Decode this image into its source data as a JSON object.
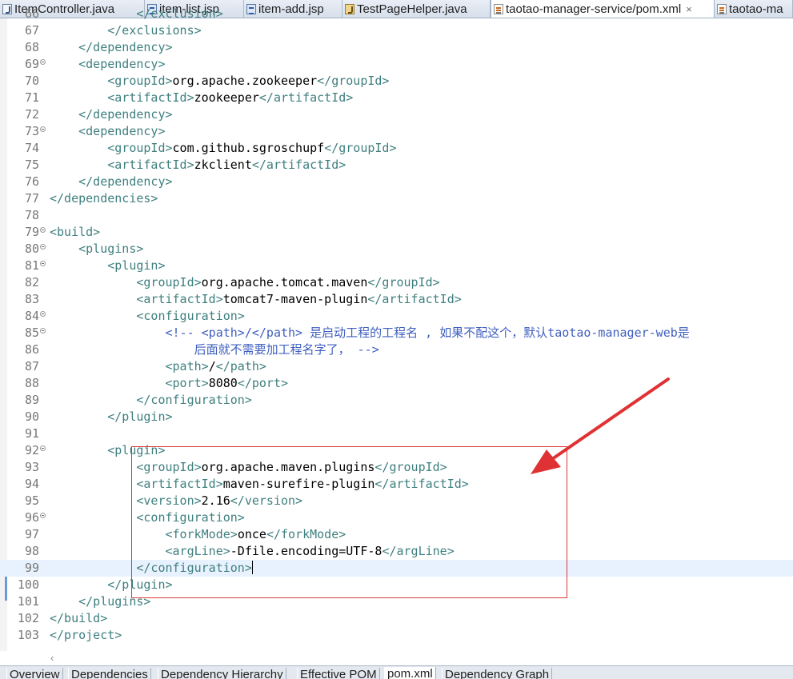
{
  "editor_tabs": [
    {
      "label": "ItemController.java",
      "icon": "java-file-icon",
      "active": false
    },
    {
      "label": "item-list.jsp",
      "icon": "jsp-file-icon",
      "active": false
    },
    {
      "label": "item-add.jsp",
      "icon": "jsp-file-icon",
      "active": false
    },
    {
      "label": "TestPageHelper.java",
      "icon": "java-file-icon",
      "active": false
    },
    {
      "label": "taotao-manager-service/pom.xml",
      "icon": "xml-file-icon",
      "active": true
    },
    {
      "label": "taotao-ma",
      "icon": "xml-file-icon",
      "active": false
    }
  ],
  "close_glyph": "×",
  "lines": [
    {
      "n": "66",
      "fold": false,
      "text": "            </exclusion>"
    },
    {
      "n": "67",
      "fold": false,
      "text": "        </exclusions>"
    },
    {
      "n": "68",
      "fold": false,
      "text": "    </dependency>"
    },
    {
      "n": "69",
      "fold": true,
      "text": "    <dependency>"
    },
    {
      "n": "70",
      "fold": false,
      "text": "        <groupId>org.apache.zookeeper</groupId>"
    },
    {
      "n": "71",
      "fold": false,
      "text": "        <artifactId>zookeeper</artifactId>"
    },
    {
      "n": "72",
      "fold": false,
      "text": "    </dependency>"
    },
    {
      "n": "73",
      "fold": true,
      "text": "    <dependency>"
    },
    {
      "n": "74",
      "fold": false,
      "text": "        <groupId>com.github.sgroschupf</groupId>"
    },
    {
      "n": "75",
      "fold": false,
      "text": "        <artifactId>zkclient</artifactId>"
    },
    {
      "n": "76",
      "fold": false,
      "text": "    </dependency>"
    },
    {
      "n": "77",
      "fold": false,
      "text": "</dependencies>"
    },
    {
      "n": "78",
      "fold": false,
      "text": ""
    },
    {
      "n": "79",
      "fold": true,
      "text": "<build>"
    },
    {
      "n": "80",
      "fold": true,
      "text": "    <plugins>"
    },
    {
      "n": "81",
      "fold": true,
      "text": "        <plugin>"
    },
    {
      "n": "82",
      "fold": false,
      "text": "            <groupId>org.apache.tomcat.maven</groupId>"
    },
    {
      "n": "83",
      "fold": false,
      "text": "            <artifactId>tomcat7-maven-plugin</artifactId>"
    },
    {
      "n": "84",
      "fold": true,
      "text": "            <configuration>"
    },
    {
      "n": "85",
      "fold": true,
      "text": "                <!-- <path>/</path> 是启动工程的工程名 , 如果不配这个，默认taotao-manager-web是"
    },
    {
      "n": "86",
      "fold": false,
      "text": "                    后面就不需要加工程名字了， -->"
    },
    {
      "n": "87",
      "fold": false,
      "text": "                <path>/</path>"
    },
    {
      "n": "88",
      "fold": false,
      "text": "                <port>8080</port>"
    },
    {
      "n": "89",
      "fold": false,
      "text": "            </configuration>"
    },
    {
      "n": "90",
      "fold": false,
      "text": "        </plugin>"
    },
    {
      "n": "91",
      "fold": false,
      "text": ""
    },
    {
      "n": "92",
      "fold": true,
      "text": "        <plugin>"
    },
    {
      "n": "93",
      "fold": false,
      "text": "            <groupId>org.apache.maven.plugins</groupId>"
    },
    {
      "n": "94",
      "fold": false,
      "text": "            <artifactId>maven-surefire-plugin</artifactId>"
    },
    {
      "n": "95",
      "fold": false,
      "text": "            <version>2.16</version>"
    },
    {
      "n": "96",
      "fold": true,
      "text": "            <configuration>"
    },
    {
      "n": "97",
      "fold": false,
      "text": "                <forkMode>once</forkMode>"
    },
    {
      "n": "98",
      "fold": false,
      "text": "                <argLine>-Dfile.encoding=UTF-8</argLine>"
    },
    {
      "n": "99",
      "fold": false,
      "text": "            </configuration>",
      "current": true
    },
    {
      "n": "100",
      "fold": false,
      "text": "        </plugin>"
    },
    {
      "n": "101",
      "fold": false,
      "text": "    </plugins>"
    },
    {
      "n": "102",
      "fold": false,
      "text": "</build>"
    },
    {
      "n": "103",
      "fold": false,
      "text": "</project>"
    }
  ],
  "bottom_tabs": [
    {
      "label": "Overview",
      "active": false
    },
    {
      "label": "Dependencies",
      "active": false
    },
    {
      "label": "Dependency Hierarchy",
      "active": false
    },
    {
      "label": "Effective POM",
      "active": false
    },
    {
      "label": "pom.xml",
      "active": true
    },
    {
      "label": "Dependency Graph",
      "active": false
    }
  ],
  "scroll_left_glyph": "‹",
  "colors": {
    "tag": "#3f7f7f",
    "comment": "#3f5fbf",
    "current_line": "#e8f2fe",
    "annotation": "#d9383a"
  }
}
